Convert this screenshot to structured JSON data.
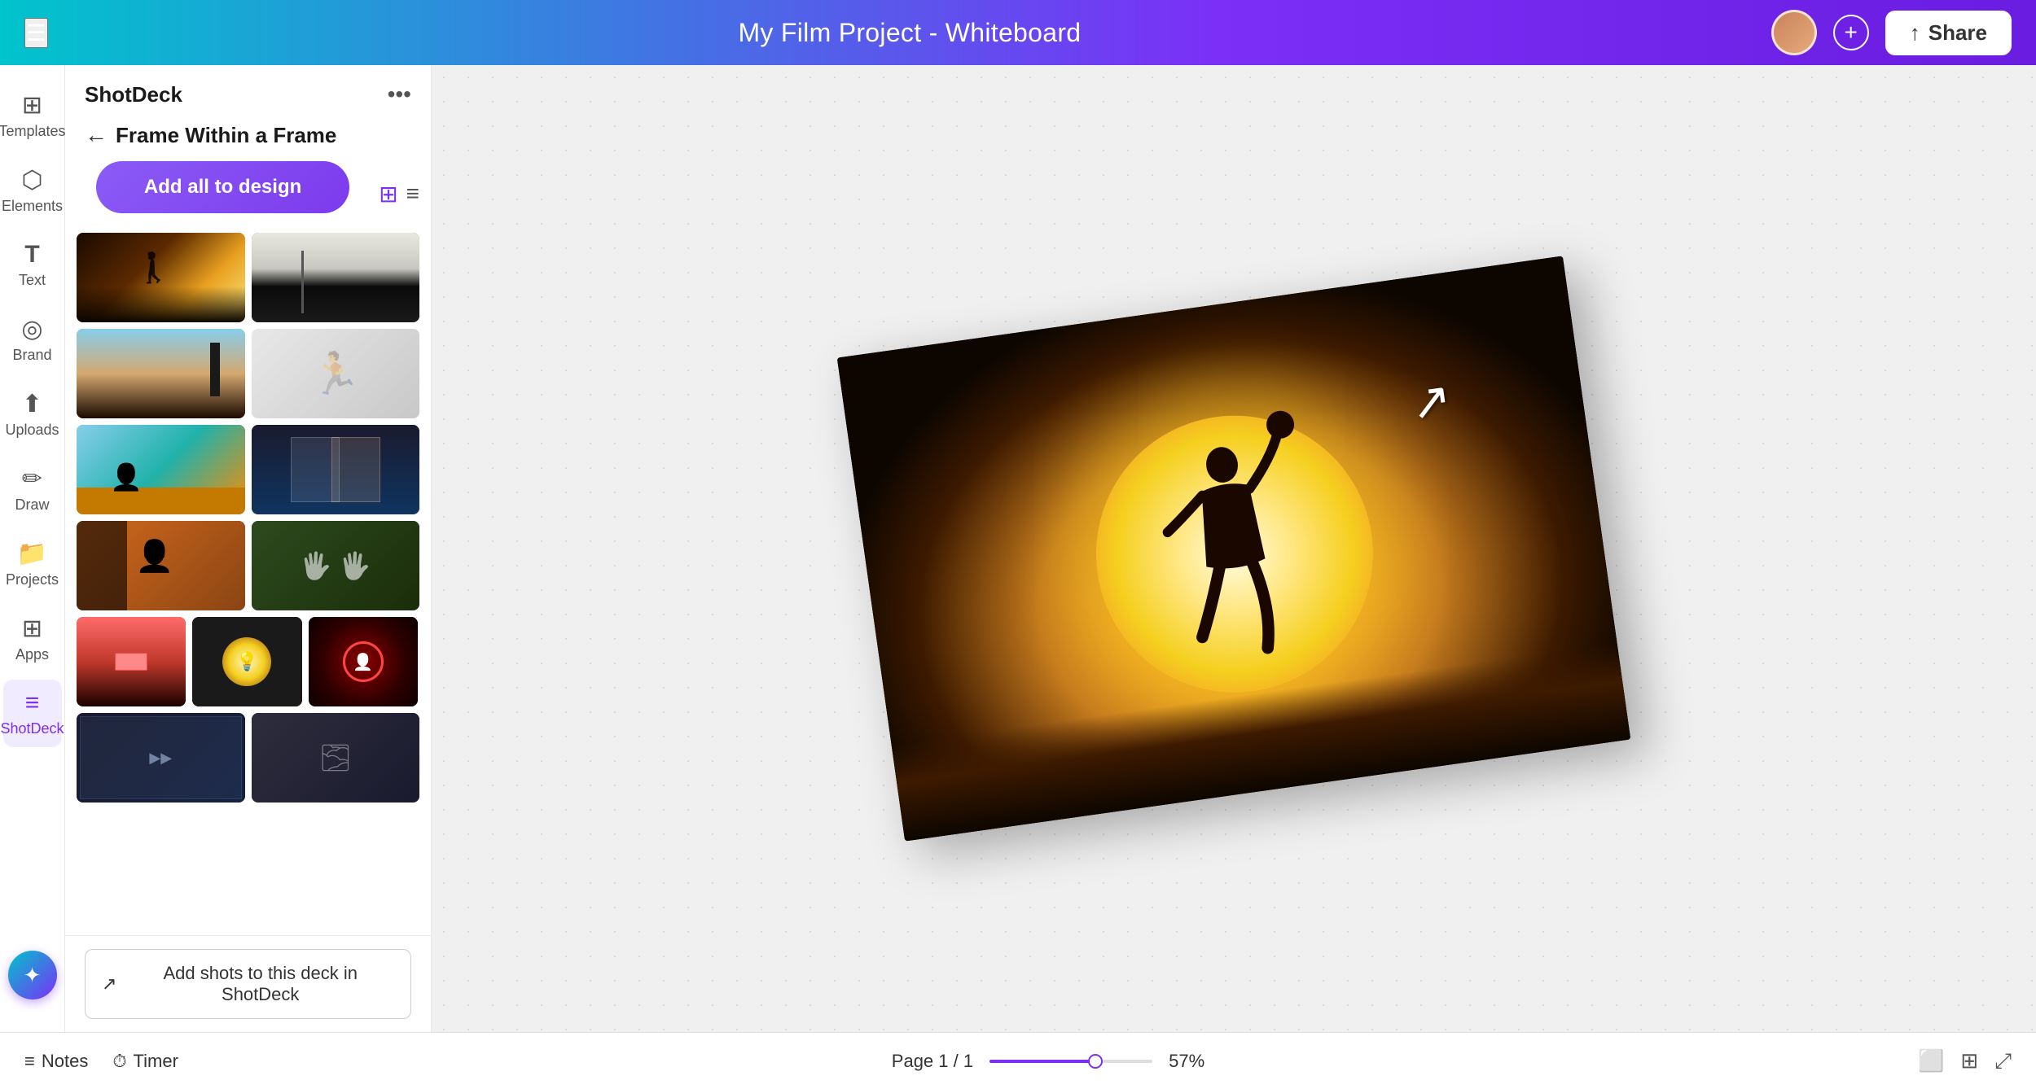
{
  "header": {
    "title": "My Film Project - Whiteboard",
    "share_label": "Share",
    "add_icon": "+",
    "menu_icon": "☰"
  },
  "sidebar": {
    "items": [
      {
        "id": "templates",
        "label": "Templates",
        "icon": "⊞"
      },
      {
        "id": "elements",
        "label": "Elements",
        "icon": "⬡"
      },
      {
        "id": "text",
        "label": "Text",
        "icon": "T"
      },
      {
        "id": "brand",
        "label": "Brand",
        "icon": "◎"
      },
      {
        "id": "uploads",
        "label": "Uploads",
        "icon": "⬆"
      },
      {
        "id": "draw",
        "label": "Draw",
        "icon": "✏"
      },
      {
        "id": "projects",
        "label": "Projects",
        "icon": "📁"
      },
      {
        "id": "apps",
        "label": "Apps",
        "icon": "⊞"
      },
      {
        "id": "shotdeck",
        "label": "ShotDeck",
        "icon": "≡"
      }
    ],
    "magic_icon": "✦"
  },
  "panel": {
    "title": "ShotDeck",
    "more_label": "•••",
    "breadcrumb": "Frame Within a Frame",
    "add_all_label": "Add all to design",
    "back_icon": "←",
    "thumbnails": [
      {
        "id": 1,
        "class": "thumb-1",
        "row": 1,
        "size": "half"
      },
      {
        "id": 2,
        "class": "thumb-2",
        "row": 1,
        "size": "half"
      },
      {
        "id": 3,
        "class": "thumb-3",
        "row": 2,
        "size": "half"
      },
      {
        "id": 4,
        "class": "thumb-4",
        "row": 2,
        "size": "half"
      },
      {
        "id": 5,
        "class": "thumb-5",
        "row": 3,
        "size": "half"
      },
      {
        "id": 6,
        "class": "thumb-6",
        "row": 3,
        "size": "half"
      },
      {
        "id": 7,
        "class": "thumb-7",
        "row": 4,
        "size": "half"
      },
      {
        "id": 8,
        "class": "thumb-8",
        "row": 4,
        "size": "half"
      },
      {
        "id": 9,
        "class": "thumb-9",
        "row": 5,
        "size": "third"
      },
      {
        "id": 10,
        "class": "thumb-10",
        "row": 5,
        "size": "third"
      },
      {
        "id": 11,
        "class": "thumb-11",
        "row": 5,
        "size": "third"
      },
      {
        "id": 12,
        "class": "thumb-13",
        "row": 6,
        "size": "half"
      },
      {
        "id": 13,
        "class": "thumb-14",
        "row": 6,
        "size": "half"
      }
    ],
    "footer_btn": "Add shots to this deck in ShotDeck",
    "footer_icon": "↗"
  },
  "canvas": {
    "scene_description": "Basketball player silhouette jumping against large sun"
  },
  "bottom_bar": {
    "notes_label": "Notes",
    "timer_label": "Timer",
    "page_info": "Page 1 / 1",
    "zoom_level": "57%",
    "notes_icon": "≡",
    "timer_icon": "⏱",
    "desktop_icon": "⬜",
    "grid_icon": "⊞",
    "expand_icon": "⤢"
  }
}
